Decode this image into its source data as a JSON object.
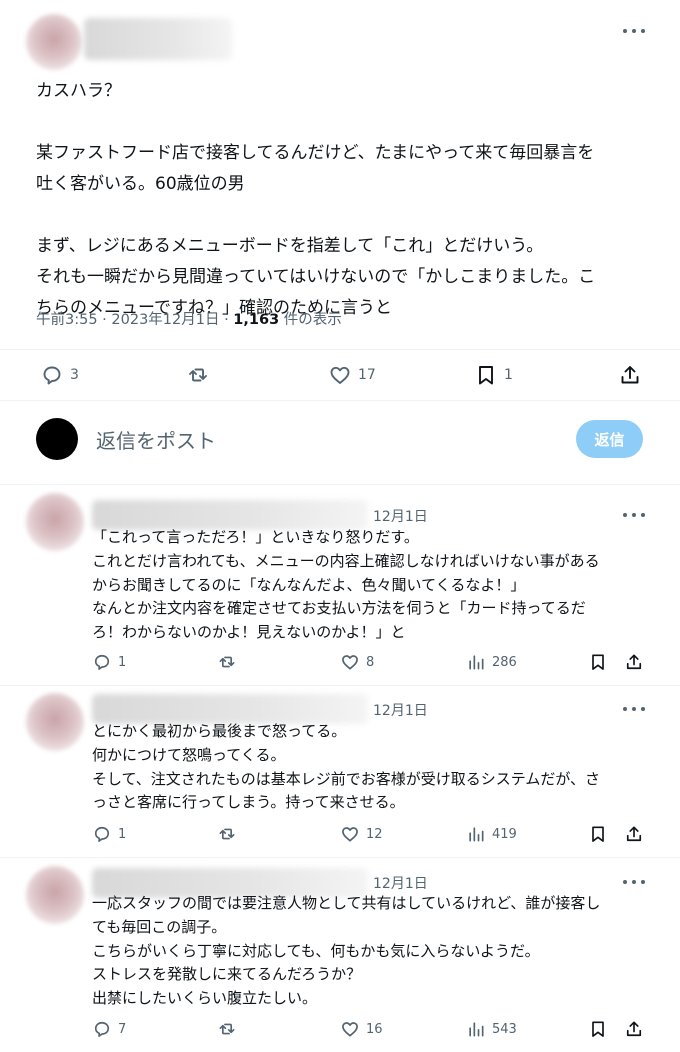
{
  "main_post": {
    "text_lines": [
      "カスハラ？",
      "",
      "某ファストフード店で接客してるんだけど、たまにやって来て毎回暴言を",
      "吐く客がいる。60歳位の男",
      "",
      "まず、レジにあるメニューボードを指差して「これ」とだけいう。",
      "それも一瞬だから見間違っていてはいけないので「かしこまりました。こ",
      "ちらのメニューですね？」確認のために言うと"
    ],
    "meta_time": "午前3:55 · 2023年12月1日 · ",
    "meta_views": "1,163",
    "meta_views_suffix": " 件の表示",
    "replies": "3",
    "reposts": "",
    "likes": "17",
    "bookmarks": "1"
  },
  "composer": {
    "placeholder": "返信をポスト",
    "button_label": "返信"
  },
  "comments": [
    {
      "date": "12月1日",
      "lines": [
        "「これって言っただろ！」といきなり怒りだす。",
        "これとだけ言われても、メニューの内容上確認しなければいけない事がある",
        "からお聞きしてるのに「なんなんだよ、色々聞いてくるなよ！」",
        "なんとか注文内容を確定させてお支払い方法を伺うと「カード持ってるだ",
        "ろ！わからないのかよ！見えないのかよ！」と"
      ],
      "replies": "1",
      "likes": "8",
      "views": "286"
    },
    {
      "date": "12月1日",
      "lines": [
        "とにかく最初から最後まで怒ってる。",
        "何かにつけて怒鳴ってくる。",
        "そして、注文されたものは基本レジ前でお客様が受け取るシステムだが、さ",
        "っさと客席に行ってしまう。持って来させる。"
      ],
      "replies": "1",
      "likes": "12",
      "views": "419"
    },
    {
      "date": "12月1日",
      "lines": [
        "一応スタッフの間では要注意人物として共有はしているけれど、誰が接客し",
        "ても毎回この調子。",
        "こちらがいくら丁寧に対応しても、何もかも気に入らないようだ。",
        "ストレスを発散しに来てるんだろうか？",
        "出禁にしたいくらい腹立たしい。"
      ],
      "replies": "7",
      "likes": "16",
      "views": "543"
    }
  ],
  "icons": {
    "more": "more-dots-icon",
    "reply": "reply-bubble-icon",
    "repost": "repost-icon",
    "like": "heart-icon",
    "bookmark": "bookmark-icon",
    "share": "share-icon",
    "views": "views-chart-icon"
  },
  "colors": {
    "accent_disabled": "#8ecdf7",
    "muted": "#536471",
    "text": "#0f1419"
  }
}
